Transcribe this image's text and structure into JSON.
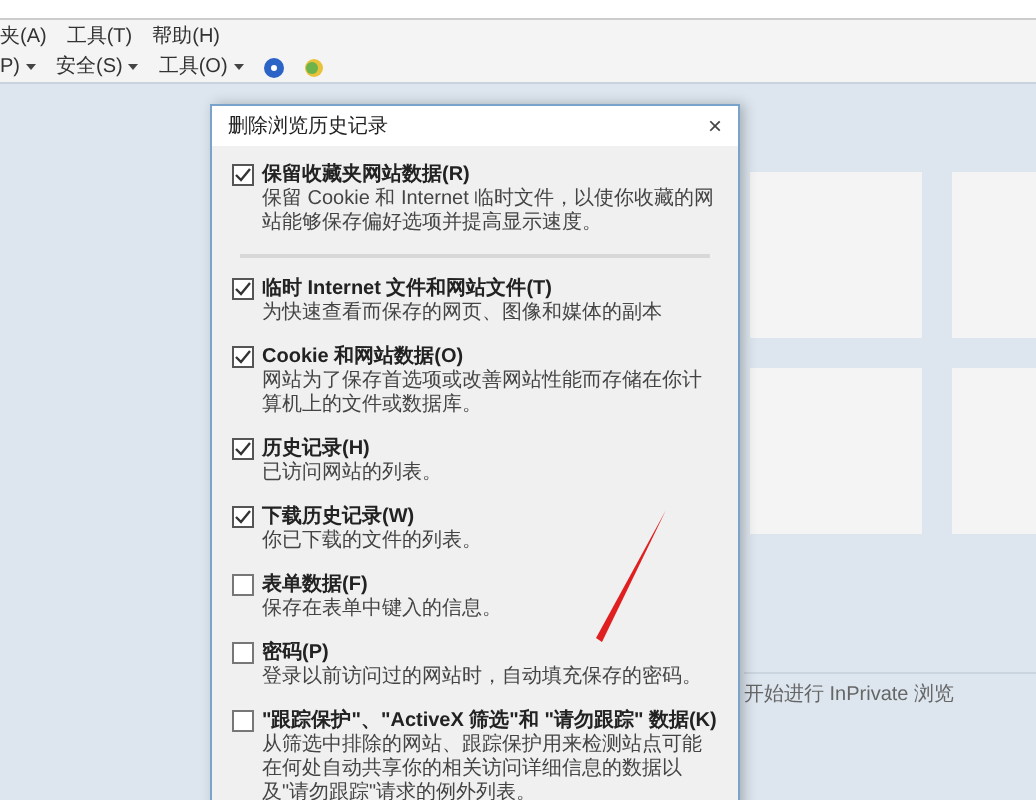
{
  "menu_bar": [
    "夹(A)",
    "工具(T)",
    "帮助(H)"
  ],
  "command_bar": [
    {
      "kind": "text",
      "label": "P)"
    },
    {
      "kind": "text",
      "label": "安全(S)"
    },
    {
      "kind": "text",
      "label": "工具(O)"
    },
    {
      "kind": "help"
    }
  ],
  "dialog": {
    "title": "删除浏览历史记录",
    "close": "×",
    "options": [
      {
        "label": "保留收藏夹网站数据(R)",
        "description": "保留 Cookie 和 Internet 临时文件，以使你收藏的网站能够保存偏好选项并提高显示速度。",
        "checked": true
      },
      {
        "label": "临时 Internet 文件和网站文件(T)",
        "description": "为快速查看而保存的网页、图像和媒体的副本",
        "checked": true
      },
      {
        "label": "Cookie 和网站数据(O)",
        "description": "网站为了保存首选项或改善网站性能而存储在你计算机上的文件或数据库。",
        "checked": true
      },
      {
        "label": "历史记录(H)",
        "description": "已访问网站的列表。",
        "checked": true
      },
      {
        "label": "下载历史记录(W)",
        "description": "你已下载的文件的列表。",
        "checked": true
      },
      {
        "label": "表单数据(F)",
        "description": "保存在表单中键入的信息。",
        "checked": false
      },
      {
        "label": "密码(P)",
        "description": "登录以前访问过的网站时，自动填充保存的密码。",
        "checked": false
      },
      {
        "label": "\"跟踪保护\"、\"ActiveX 筛选\"和 \"请勿跟踪\" 数据(K)",
        "description": "从筛选中排除的网站、跟踪保护用来检测站点可能在何处自动共享你的相关访问详细信息的数据以及\"请勿跟踪\"请求的例外列表。",
        "checked": false
      }
    ]
  },
  "inprivate_link": "开始进行 InPrivate 浏览"
}
